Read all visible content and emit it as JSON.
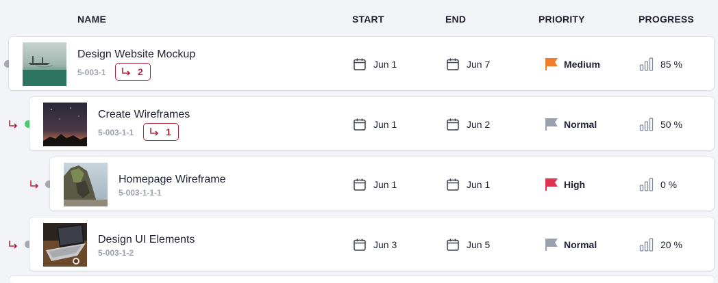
{
  "columns": {
    "name": "NAME",
    "start": "START",
    "end": "END",
    "priority": "PRIORITY",
    "progress": "PROGRESS"
  },
  "colors": {
    "medium_flag": "#f07d2a",
    "high_flag": "#e0314f",
    "normal_flag": "#9aa1ad",
    "subtask_accent": "#b3243f",
    "status_green": "#4ccd6b",
    "status_gray": "#a5a9b3"
  },
  "rows": [
    {
      "title": "Design Website Mockup",
      "code": "5-003-1",
      "subtasks": "2",
      "start": "Jun 1",
      "end": "Jun 7",
      "priority": "Medium",
      "progress": "85 %",
      "thumb_icon": "lake-canoe-photo"
    },
    {
      "title": "Create Wireframes",
      "code": "5-003-1-1",
      "subtasks": "1",
      "start": "Jun 1",
      "end": "Jun 2",
      "priority": "Normal",
      "progress": "50 %",
      "thumb_icon": "night-sky-photo"
    },
    {
      "title": "Homepage Wireframe",
      "code": "5-003-1-1-1",
      "start": "Jun 1",
      "end": "Jun 1",
      "priority": "High",
      "progress": "0 %",
      "thumb_icon": "coastal-cliff-photo"
    },
    {
      "title": "Design UI Elements",
      "code": "5-003-1-2",
      "start": "Jun 3",
      "end": "Jun 5",
      "priority": "Normal",
      "progress": "20 %",
      "thumb_icon": "laptop-desk-photo"
    }
  ]
}
